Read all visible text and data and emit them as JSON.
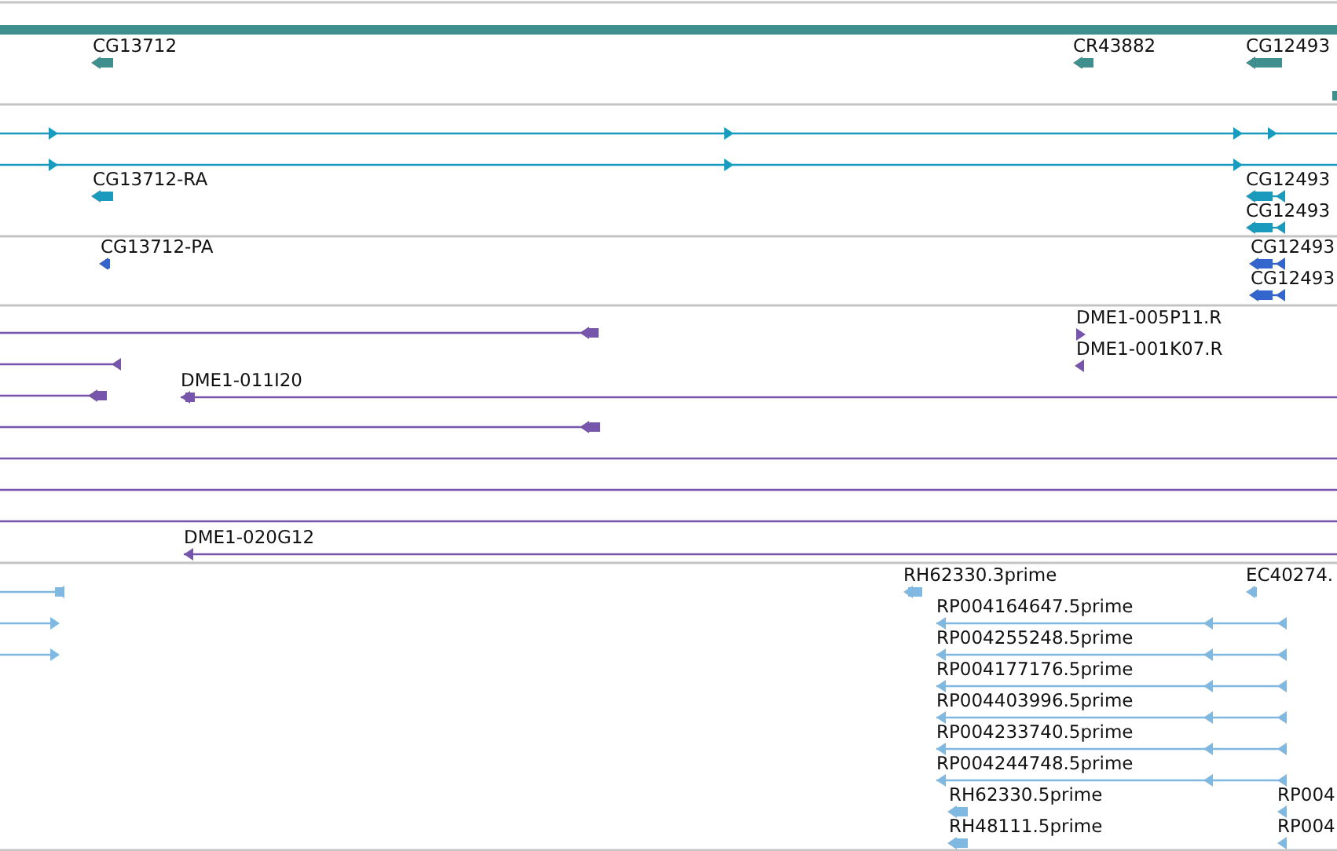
{
  "tracks": [
    {
      "color": "#3f8f8f",
      "features": [
        {
          "label": "CG13712",
          "kind": "block",
          "reverse": true
        },
        {
          "label": "CR43882",
          "kind": "block",
          "reverse": true
        },
        {
          "label": "CG12493",
          "kind": "block",
          "reverse": true
        },
        {
          "kind": "block"
        }
      ]
    },
    {
      "color": "#1a9bbd",
      "features": [
        {
          "kind": "line",
          "reverse": false
        },
        {
          "kind": "line",
          "reverse": false
        },
        {
          "label": "CG13712-RA",
          "kind": "block",
          "reverse": true
        },
        {
          "label": "CG12493",
          "kind": "mixed",
          "reverse": true
        },
        {
          "label": "CG12493",
          "kind": "mixed",
          "reverse": true
        }
      ]
    },
    {
      "color": "#3366cc",
      "features": [
        {
          "label": "CG13712-PA",
          "kind": "block",
          "reverse": true
        },
        {
          "label": "CG12493",
          "kind": "mixed",
          "reverse": true
        },
        {
          "label": "CG12493",
          "kind": "mixed",
          "reverse": true
        }
      ]
    },
    {
      "color": "#7755aa",
      "features": [
        {
          "kind": "mixed",
          "reverse": true
        },
        {
          "kind": "line",
          "reverse": true
        },
        {
          "kind": "mixed",
          "reverse": true
        },
        {
          "kind": "mixed",
          "reverse": true
        },
        {
          "kind": "line"
        },
        {
          "kind": "line"
        },
        {
          "kind": "line"
        },
        {
          "label": "DME1-011I20",
          "kind": "mixed",
          "reverse": true
        },
        {
          "label": "DME1-020G12",
          "kind": "line",
          "reverse": true
        },
        {
          "label": "DME1-005P11.R",
          "kind": "tick",
          "reverse": false
        },
        {
          "label": "DME1-001K07.R",
          "kind": "tick",
          "reverse": true
        }
      ]
    },
    {
      "color": "#7fb8e0",
      "features": [
        {
          "kind": "mixed",
          "reverse": true
        },
        {
          "kind": "line",
          "reverse": false
        },
        {
          "kind": "line",
          "reverse": false
        },
        {
          "label": "RH62330.3prime",
          "kind": "block",
          "reverse": true
        },
        {
          "label": "EC40274.",
          "kind": "block",
          "reverse": true
        },
        {
          "label": "RP004164647.5prime",
          "kind": "line",
          "reverse": true
        },
        {
          "label": "RP004255248.5prime",
          "kind": "line",
          "reverse": true
        },
        {
          "label": "RP004177176.5prime",
          "kind": "line",
          "reverse": true
        },
        {
          "label": "RP004403996.5prime",
          "kind": "line",
          "reverse": true
        },
        {
          "label": "RP004233740.5prime",
          "kind": "line",
          "reverse": true
        },
        {
          "label": "RP004244748.5prime",
          "kind": "line",
          "reverse": true
        },
        {
          "label": "RH62330.5prime",
          "kind": "block",
          "reverse": true
        },
        {
          "label": "RH48111.5prime",
          "kind": "block",
          "reverse": true
        },
        {
          "label": "RP004",
          "kind": "tick",
          "reverse": true
        },
        {
          "label": "RP004",
          "kind": "tick",
          "reverse": true
        }
      ]
    }
  ]
}
